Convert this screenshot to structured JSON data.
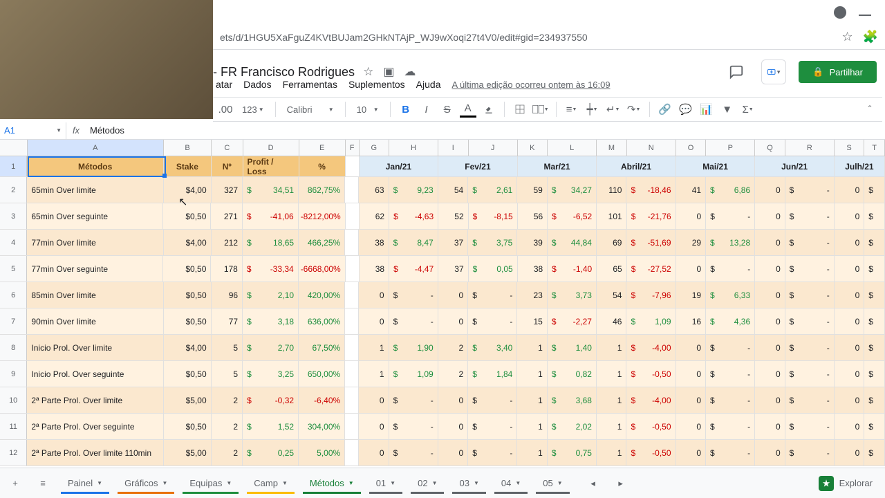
{
  "browser": {
    "url": "ets/d/1HGU5XaFguZ4KVtBUJam2GHkNTAjP_WJ9wXoqi27t4V0/edit#gid=234937550"
  },
  "doc": {
    "title": "- FR Francisco Rodrigues",
    "share": "Partilhar",
    "menus": {
      "format": "atar",
      "data": "Dados",
      "tools": "Ferramentas",
      "addons": "Suplementos",
      "help": "Ajuda"
    },
    "last_edit": "A última edição ocorreu ontem às 16:09",
    "zoom": "123",
    "font": "Calibri",
    "fontsize": "10",
    "decimals": ".00"
  },
  "name_box": {
    "ref": "A1",
    "value": "Métodos"
  },
  "cols": [
    "A",
    "B",
    "C",
    "D",
    "E",
    "F",
    "G",
    "H",
    "I",
    "J",
    "K",
    "L",
    "M",
    "N",
    "O",
    "P",
    "Q",
    "R",
    "S",
    "T"
  ],
  "header": {
    "A": "Métodos",
    "B": "Stake",
    "C": "Nº",
    "D": "Profit / Loss",
    "E": "%",
    "GH": "Jan/21",
    "IJ": "Fev/21",
    "KL": "Mar/21",
    "MN": "Abril/21",
    "OP": "Mai/21",
    "QR": "Jun/21",
    "ST": "Julh/21"
  },
  "rows": [
    {
      "n": "2",
      "A": "65min Over limite",
      "B": "$4,00",
      "C": "327",
      "D": "34,51",
      "Dcol": "green",
      "E": "862,75%",
      "Ecol": "green",
      "G": "63",
      "H": "9,23",
      "Hcol": "green",
      "I": "54",
      "J": "2,61",
      "Jcol": "green",
      "K": "59",
      "L": "34,27",
      "Lcol": "green",
      "M": "110",
      "N": "-18,46",
      "Ncol": "red",
      "O": "41",
      "P": "6,86",
      "Pcol": "green",
      "Q": "0",
      "R": "-",
      "S": "0"
    },
    {
      "n": "3",
      "A": "65min Over seguinte",
      "B": "$0,50",
      "C": "271",
      "D": "-41,06",
      "Dcol": "red",
      "E": "-8212,00%",
      "Ecol": "red",
      "G": "62",
      "H": "-4,63",
      "Hcol": "red",
      "I": "52",
      "J": "-8,15",
      "Jcol": "red",
      "K": "56",
      "L": "-6,52",
      "Lcol": "red",
      "M": "101",
      "N": "-21,76",
      "Ncol": "red",
      "O": "0",
      "P": "-",
      "Pcol": "",
      "Q": "0",
      "R": "-",
      "S": "0"
    },
    {
      "n": "4",
      "A": "77min Over limite",
      "B": "$4,00",
      "C": "212",
      "D": "18,65",
      "Dcol": "green",
      "E": "466,25%",
      "Ecol": "green",
      "G": "38",
      "H": "8,47",
      "Hcol": "green",
      "I": "37",
      "J": "3,75",
      "Jcol": "green",
      "K": "39",
      "L": "44,84",
      "Lcol": "green",
      "M": "69",
      "N": "-51,69",
      "Ncol": "red",
      "O": "29",
      "P": "13,28",
      "Pcol": "green",
      "Q": "0",
      "R": "-",
      "S": "0"
    },
    {
      "n": "5",
      "A": "77min Over seguinte",
      "B": "$0,50",
      "C": "178",
      "D": "-33,34",
      "Dcol": "red",
      "E": "-6668,00%",
      "Ecol": "red",
      "G": "38",
      "H": "-4,47",
      "Hcol": "red",
      "I": "37",
      "J": "0,05",
      "Jcol": "green",
      "K": "38",
      "L": "-1,40",
      "Lcol": "red",
      "M": "65",
      "N": "-27,52",
      "Ncol": "red",
      "O": "0",
      "P": "-",
      "Pcol": "",
      "Q": "0",
      "R": "-",
      "S": "0"
    },
    {
      "n": "6",
      "A": "85min Over limite",
      "B": "$0,50",
      "C": "96",
      "D": "2,10",
      "Dcol": "green",
      "E": "420,00%",
      "Ecol": "green",
      "G": "0",
      "H": "-",
      "Hcol": "",
      "I": "0",
      "J": "-",
      "Jcol": "",
      "K": "23",
      "L": "3,73",
      "Lcol": "green",
      "M": "54",
      "N": "-7,96",
      "Ncol": "red",
      "O": "19",
      "P": "6,33",
      "Pcol": "green",
      "Q": "0",
      "R": "-",
      "S": "0"
    },
    {
      "n": "7",
      "A": "90min Over limite",
      "B": "$0,50",
      "C": "77",
      "D": "3,18",
      "Dcol": "green",
      "E": "636,00%",
      "Ecol": "green",
      "G": "0",
      "H": "-",
      "Hcol": "",
      "I": "0",
      "J": "-",
      "Jcol": "",
      "K": "15",
      "L": "-2,27",
      "Lcol": "red",
      "M": "46",
      "N": "1,09",
      "Ncol": "green",
      "O": "16",
      "P": "4,36",
      "Pcol": "green",
      "Q": "0",
      "R": "-",
      "S": "0"
    },
    {
      "n": "8",
      "A": "Inicio Prol. Over limite",
      "B": "$4,00",
      "C": "5",
      "D": "2,70",
      "Dcol": "green",
      "E": "67,50%",
      "Ecol": "green",
      "G": "1",
      "H": "1,90",
      "Hcol": "green",
      "I": "2",
      "J": "3,40",
      "Jcol": "green",
      "K": "1",
      "L": "1,40",
      "Lcol": "green",
      "M": "1",
      "N": "-4,00",
      "Ncol": "red",
      "O": "0",
      "P": "-",
      "Pcol": "",
      "Q": "0",
      "R": "-",
      "S": "0"
    },
    {
      "n": "9",
      "A": "Inicio Prol. Over seguinte",
      "B": "$0,50",
      "C": "5",
      "D": "3,25",
      "Dcol": "green",
      "E": "650,00%",
      "Ecol": "green",
      "G": "1",
      "H": "1,09",
      "Hcol": "green",
      "I": "2",
      "J": "1,84",
      "Jcol": "green",
      "K": "1",
      "L": "0,82",
      "Lcol": "green",
      "M": "1",
      "N": "-0,50",
      "Ncol": "red",
      "O": "0",
      "P": "-",
      "Pcol": "",
      "Q": "0",
      "R": "-",
      "S": "0"
    },
    {
      "n": "10",
      "A": "2ª Parte Prol. Over limite",
      "B": "$5,00",
      "C": "2",
      "D": "-0,32",
      "Dcol": "red",
      "E": "-6,40%",
      "Ecol": "red",
      "G": "0",
      "H": "-",
      "Hcol": "",
      "I": "0",
      "J": "-",
      "Jcol": "",
      "K": "1",
      "L": "3,68",
      "Lcol": "green",
      "M": "1",
      "N": "-4,00",
      "Ncol": "red",
      "O": "0",
      "P": "-",
      "Pcol": "",
      "Q": "0",
      "R": "-",
      "S": "0"
    },
    {
      "n": "11",
      "A": "2ª Parte Prol. Over seguinte",
      "B": "$0,50",
      "C": "2",
      "D": "1,52",
      "Dcol": "green",
      "E": "304,00%",
      "Ecol": "green",
      "G": "0",
      "H": "-",
      "Hcol": "",
      "I": "0",
      "J": "-",
      "Jcol": "",
      "K": "1",
      "L": "2,02",
      "Lcol": "green",
      "M": "1",
      "N": "-0,50",
      "Ncol": "red",
      "O": "0",
      "P": "-",
      "Pcol": "",
      "Q": "0",
      "R": "-",
      "S": "0"
    },
    {
      "n": "12",
      "A": "2ª Parte Prol. Over limite 110min",
      "B": "$5,00",
      "C": "2",
      "D": "0,25",
      "Dcol": "green",
      "E": "5,00%",
      "Ecol": "green",
      "G": "0",
      "H": "-",
      "Hcol": "",
      "I": "0",
      "J": "-",
      "Jcol": "",
      "K": "1",
      "L": "0,75",
      "Lcol": "green",
      "M": "1",
      "N": "-0,50",
      "Ncol": "red",
      "O": "0",
      "P": "-",
      "Pcol": "",
      "Q": "0",
      "R": "-",
      "S": "0"
    }
  ],
  "tabs": {
    "items": [
      {
        "label": "Painel",
        "color": "#1a73e8"
      },
      {
        "label": "Gráficos",
        "color": "#e8710a"
      },
      {
        "label": "Equipas",
        "color": "#1e8e3e"
      },
      {
        "label": "Camp",
        "color": "#fbbc04"
      },
      {
        "label": "Métodos",
        "color": "#188038",
        "active": true
      },
      {
        "label": "01",
        "color": "#5f6368"
      },
      {
        "label": "02",
        "color": "#5f6368"
      },
      {
        "label": "03",
        "color": "#5f6368"
      },
      {
        "label": "04",
        "color": "#5f6368"
      },
      {
        "label": "05",
        "color": "#5f6368"
      }
    ],
    "explore": "Explorar"
  }
}
